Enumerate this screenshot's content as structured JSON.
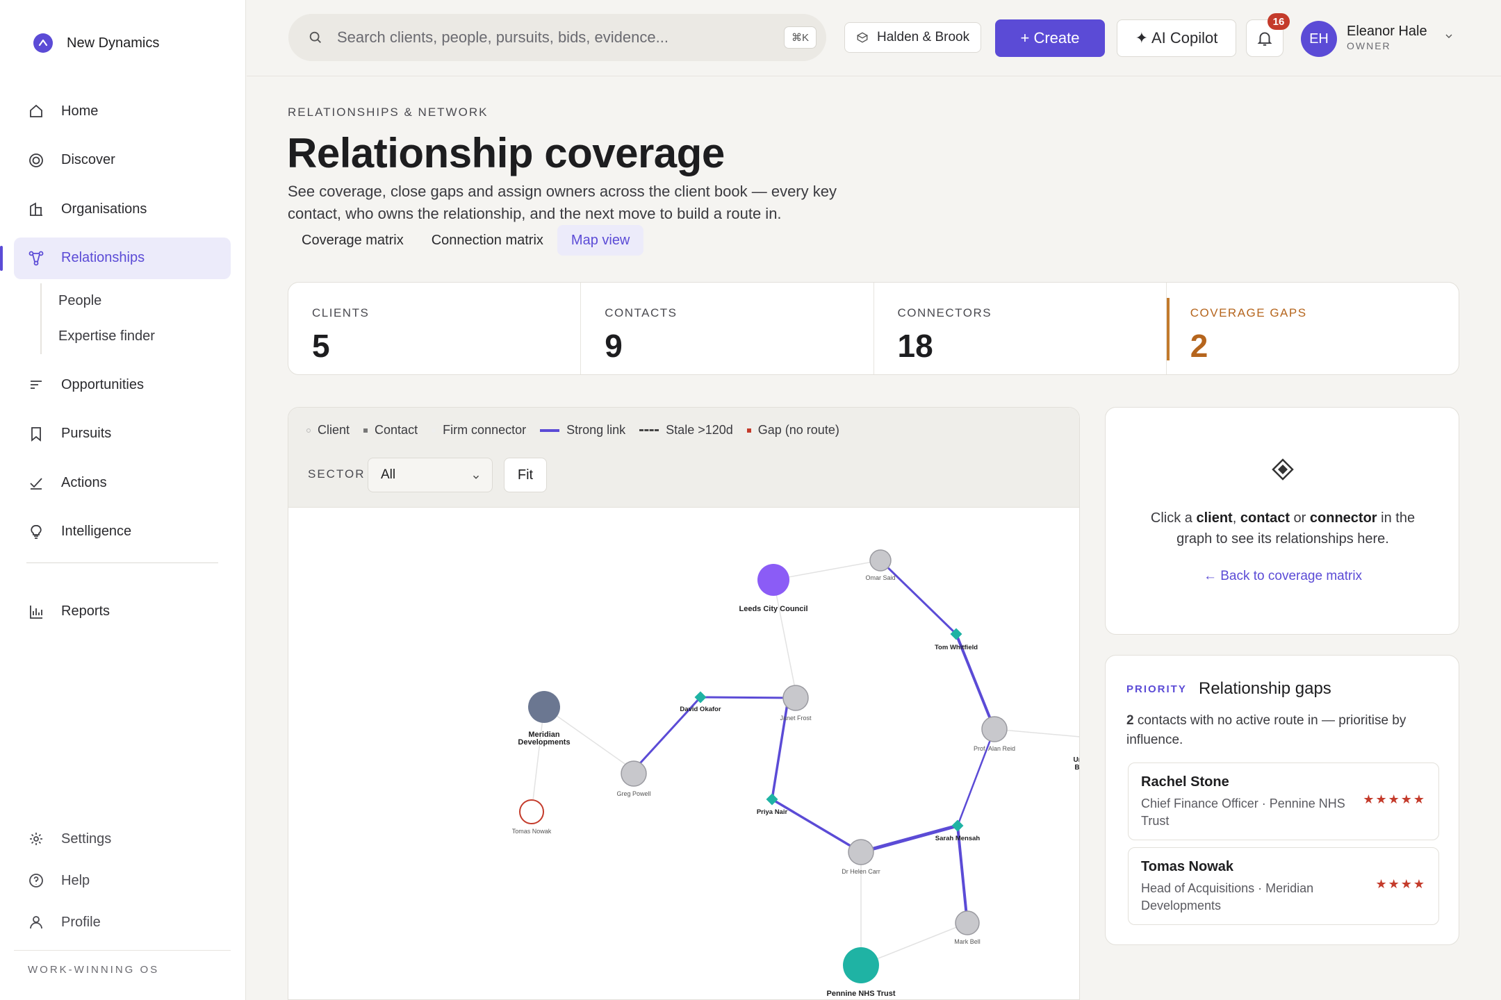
{
  "app": {
    "name": "New Dynamics",
    "tagline": "WORK-WINNING OS"
  },
  "sidebar": {
    "items": [
      {
        "label": "Home"
      },
      {
        "label": "Discover"
      },
      {
        "label": "Organisations"
      },
      {
        "label": "Relationships"
      },
      {
        "label": "Opportunities"
      },
      {
        "label": "Pursuits"
      },
      {
        "label": "Actions"
      },
      {
        "label": "Intelligence"
      },
      {
        "label": "Reports"
      }
    ],
    "sub_items": [
      {
        "label": "People"
      },
      {
        "label": "Expertise finder"
      }
    ],
    "bottom": [
      {
        "label": "Settings"
      },
      {
        "label": "Help"
      },
      {
        "label": "Profile"
      }
    ]
  },
  "topbar": {
    "search_placeholder": "Search clients, people, pursuits, bids, evidence...",
    "search_shortcut": "⌘K",
    "workspace": "Halden & Brook",
    "create_label": "+ Create",
    "copilot_label": "✦ AI Copilot",
    "notifications": "16",
    "user": {
      "initials": "EH",
      "name": "Eleanor Hale",
      "role": "OWNER"
    }
  },
  "header": {
    "eyebrow": "RELATIONSHIPS & NETWORK",
    "title": "Relationship coverage",
    "description": "See coverage, close gaps and assign owners across the client book — every key contact, who owns the relationship, and the next move to build a route in.",
    "tabs": [
      {
        "label": "Coverage matrix"
      },
      {
        "label": "Connection matrix"
      },
      {
        "label": "Map view"
      }
    ],
    "active_tab": "Map view"
  },
  "stats": [
    {
      "label": "CLIENTS",
      "value": "5"
    },
    {
      "label": "CONTACTS",
      "value": "9"
    },
    {
      "label": "CONNECTORS",
      "value": "18"
    },
    {
      "label": "COVERAGE GAPS",
      "value": "2"
    }
  ],
  "graph": {
    "legend": {
      "client": "Client",
      "contact": "Contact",
      "connector": "Firm connector",
      "strong": "Strong link",
      "stale": "Stale >120d",
      "gap": "Gap (no route)"
    },
    "sector_label": "SECTOR",
    "sector_value": "All",
    "fit_label": "Fit",
    "colors": {
      "strong_link": "#5b4bd6",
      "connector": "#1fb3a4",
      "gap": "#c43b2b",
      "client_primary": "#8b5cf6",
      "client_teal": "#1fb3a4",
      "client_slate": "#6b7791"
    },
    "node_labels": {
      "leeds": "Leeds City Council",
      "omar": "Omar Said",
      "tom": "Tom Whitfield",
      "meridian_1": "Meridian",
      "meridian_2": "Developments",
      "david": "David Okafor",
      "janet": "Janet Frost",
      "alan": "Prof. Alan Reid",
      "greg": "Greg Powell",
      "tomas": "Tomas Nowak",
      "priya": "Priya Nair",
      "sarah": "Sarah Mensah",
      "helen": "Dr Helen Carr",
      "mark": "Mark Bell",
      "pennine": "Pennine NHS Trust",
      "edge_1": "Ur",
      "edge_2": "B"
    }
  },
  "detail": {
    "prefix": "Click a",
    "client": "client",
    "sep1": ",",
    "contact": "contact",
    "or": "or",
    "connector": "connector",
    "suffix": "in the graph to see its relationships here.",
    "back_link": "← Back to coverage matrix"
  },
  "gaps": {
    "eyebrow": "PRIORITY",
    "title": "Relationship gaps",
    "count": "2",
    "description": "contacts with no active route in — prioritise by influence.",
    "items": [
      {
        "name": "Rachel Stone",
        "role": "Chief Finance Officer · Pennine NHS Trust",
        "stars": "★★★★★"
      },
      {
        "name": "Tomas Nowak",
        "role": "Head of Acquisitions · Meridian Developments",
        "stars": "★★★★"
      }
    ]
  }
}
